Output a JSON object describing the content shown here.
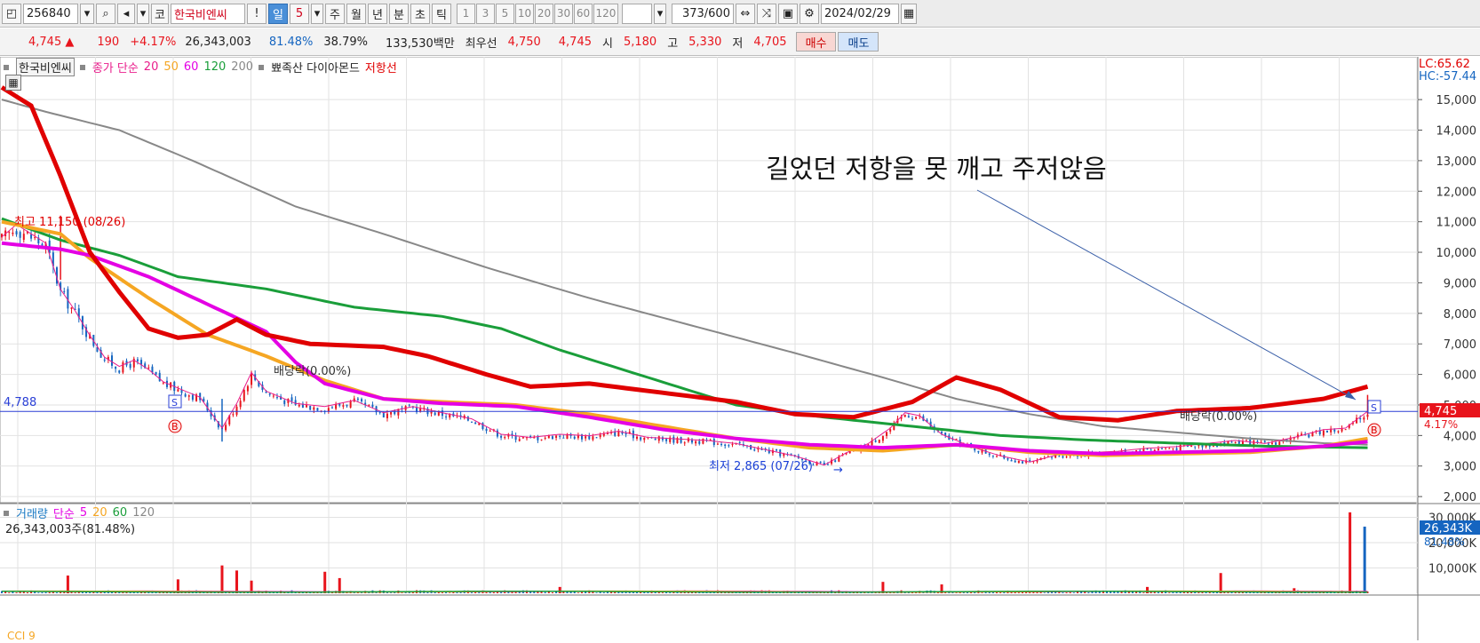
{
  "toolbar": {
    "code": "256840",
    "market": "코",
    "name": "한국비엔씨",
    "exclam": "!",
    "period_day": "일",
    "period_n": "5",
    "period_week": "주",
    "period_month": "월",
    "period_year": "년",
    "period_min": "분",
    "period_sec": "초",
    "period_tick": "틱",
    "intervals": [
      "1",
      "3",
      "5",
      "10",
      "20",
      "30",
      "60",
      "120"
    ],
    "count": "373",
    "count_max": "/600",
    "date": "2024/02/29"
  },
  "quote": {
    "price": "4,745",
    "change_arrow": "▲",
    "change": "190",
    "change_pct": "+4.17%",
    "volume": "26,343,003",
    "volume_ratio": "81.48%",
    "turnover": "38.79%",
    "amount": "133,530백만",
    "best_label": "최우선",
    "best_ask": "4,750",
    "best_bid": "4,745",
    "open_label": "시",
    "open": "5,180",
    "high_label": "고",
    "high": "5,330",
    "low_label": "저",
    "low": "4,705",
    "buy_label": "매수",
    "sell_label": "매도"
  },
  "legend": {
    "stock": "한국비엔씨",
    "ma_label": "종가 단순",
    "ma_periods": [
      "20",
      "50",
      "60",
      "120",
      "200"
    ],
    "ma_colors": [
      "#e91e8c",
      "#f5a623",
      "#e400e4",
      "#1a9e3a",
      "#888888"
    ],
    "extra1": "뾰족산 다이아몬드",
    "extra2": "저항선"
  },
  "vol_legend": {
    "label": "거래량",
    "ma_label": "단순",
    "periods": [
      "5",
      "20",
      "60",
      "120"
    ],
    "colors": [
      "#e400e4",
      "#f5a623",
      "#1a9e3a",
      "#888888"
    ],
    "value": "26,343,003주(81.48%)"
  },
  "right_info": {
    "lc": "LC:65.62",
    "hc": "HC:-57.44"
  },
  "annotations": {
    "max_label": "최고 11,150 (08/26)",
    "min_label": "최저 2,865 (07/26)",
    "dividend1": "배당락(0.00%)",
    "dividend2": "배당락(0.00%)",
    "hline_value": "4,788",
    "comment": "길었던 저항을 못 깨고 주저앉음",
    "sell_marker": "S",
    "buy_marker": "B",
    "price_tag": "4,745",
    "pct_tag": "4.17%",
    "vol_tag": "26,343K",
    "vol_pct_tag": "81.48%",
    "bottom_label": "CCI 9"
  },
  "colors": {
    "up": "#e8141c",
    "down": "#1565c0",
    "resistance": "#e00000",
    "hline": "#2a3fd6"
  },
  "chart_data": {
    "type": "candlestick",
    "y_ticks": [
      15000,
      14000,
      13000,
      12000,
      11000,
      10000,
      9000,
      8000,
      7000,
      6000,
      5000,
      4000,
      3000,
      2000
    ],
    "y_tick_labels": [
      "15,000",
      "14,000",
      "13,000",
      "12,000",
      "11,000",
      "10,000",
      "9,000",
      "8,000",
      "7,000",
      "6,000",
      "5,000",
      "4,000",
      "3,000",
      "2,000"
    ],
    "ylim": [
      1800,
      16400
    ],
    "n_bars": 373,
    "anchors_close": [
      [
        0,
        10400
      ],
      [
        10,
        10800
      ],
      [
        20,
        10500
      ],
      [
        30,
        10200
      ],
      [
        40,
        8700
      ],
      [
        50,
        8000
      ],
      [
        60,
        7200
      ],
      [
        70,
        6500
      ],
      [
        80,
        6200
      ],
      [
        90,
        6400
      ],
      [
        100,
        6100
      ],
      [
        110,
        5700
      ],
      [
        120,
        5500
      ],
      [
        135,
        5200
      ],
      [
        150,
        4200
      ],
      [
        160,
        5000
      ],
      [
        170,
        6000
      ],
      [
        180,
        5400
      ],
      [
        190,
        5200
      ],
      [
        200,
        5000
      ],
      [
        220,
        4900
      ],
      [
        240,
        5100
      ],
      [
        260,
        4700
      ],
      [
        280,
        4900
      ],
      [
        300,
        4700
      ],
      [
        320,
        4500
      ],
      [
        340,
        4000
      ],
      [
        360,
        3900
      ],
      [
        380,
        4000
      ],
      [
        400,
        3950
      ],
      [
        420,
        4100
      ],
      [
        440,
        3900
      ],
      [
        460,
        3850
      ],
      [
        480,
        3800
      ],
      [
        500,
        3700
      ],
      [
        520,
        3500
      ],
      [
        540,
        3300
      ],
      [
        560,
        3000
      ],
      [
        575,
        3400
      ],
      [
        590,
        3700
      ],
      [
        605,
        4200
      ],
      [
        615,
        4700
      ],
      [
        625,
        4600
      ],
      [
        640,
        4000
      ],
      [
        660,
        3600
      ],
      [
        680,
        3300
      ],
      [
        700,
        3100
      ],
      [
        720,
        3350
      ],
      [
        740,
        3400
      ],
      [
        760,
        3450
      ],
      [
        780,
        3550
      ],
      [
        800,
        3600
      ],
      [
        820,
        3700
      ],
      [
        840,
        3800
      ],
      [
        860,
        3700
      ],
      [
        880,
        3900
      ],
      [
        900,
        4150
      ],
      [
        915,
        4200
      ],
      [
        930,
        4745
      ]
    ],
    "ma_200": [
      [
        0,
        15000
      ],
      [
        30,
        14600
      ],
      [
        80,
        14000
      ],
      [
        130,
        13000
      ],
      [
        200,
        11500
      ],
      [
        260,
        10600
      ],
      [
        330,
        9500
      ],
      [
        400,
        8500
      ],
      [
        470,
        7600
      ],
      [
        540,
        6700
      ],
      [
        600,
        5900
      ],
      [
        650,
        5200
      ],
      [
        700,
        4700
      ],
      [
        750,
        4300
      ],
      [
        800,
        4100
      ],
      [
        850,
        3900
      ],
      [
        900,
        3750
      ],
      [
        930,
        3700
      ]
    ],
    "ma_60": [
      [
        0,
        10300
      ],
      [
        20,
        10200
      ],
      [
        40,
        10100
      ],
      [
        60,
        9900
      ],
      [
        100,
        9200
      ],
      [
        140,
        8300
      ],
      [
        180,
        7400
      ],
      [
        200,
        6400
      ],
      [
        220,
        5700
      ],
      [
        260,
        5200
      ],
      [
        300,
        5050
      ],
      [
        350,
        4950
      ],
      [
        400,
        4600
      ],
      [
        450,
        4200
      ],
      [
        500,
        3900
      ],
      [
        550,
        3700
      ],
      [
        600,
        3600
      ],
      [
        650,
        3700
      ],
      [
        700,
        3500
      ],
      [
        750,
        3400
      ],
      [
        800,
        3450
      ],
      [
        850,
        3500
      ],
      [
        900,
        3650
      ],
      [
        930,
        3800
      ]
    ],
    "ma_50": [
      [
        0,
        11000
      ],
      [
        20,
        10800
      ],
      [
        40,
        10600
      ],
      [
        60,
        9800
      ],
      [
        100,
        8500
      ],
      [
        140,
        7300
      ],
      [
        180,
        6600
      ],
      [
        220,
        5800
      ],
      [
        260,
        5200
      ],
      [
        300,
        5100
      ],
      [
        350,
        5000
      ],
      [
        400,
        4700
      ],
      [
        450,
        4300
      ],
      [
        500,
        3900
      ],
      [
        550,
        3600
      ],
      [
        600,
        3500
      ],
      [
        650,
        3700
      ],
      [
        700,
        3450
      ],
      [
        750,
        3350
      ],
      [
        800,
        3400
      ],
      [
        850,
        3450
      ],
      [
        900,
        3650
      ],
      [
        930,
        3900
      ]
    ],
    "ma_120": [
      [
        0,
        11100
      ],
      [
        40,
        10400
      ],
      [
        80,
        9900
      ],
      [
        120,
        9200
      ],
      [
        180,
        8800
      ],
      [
        240,
        8200
      ],
      [
        300,
        7900
      ],
      [
        340,
        7500
      ],
      [
        380,
        6800
      ],
      [
        420,
        6200
      ],
      [
        460,
        5600
      ],
      [
        500,
        5000
      ],
      [
        560,
        4600
      ],
      [
        620,
        4300
      ],
      [
        680,
        4000
      ],
      [
        740,
        3850
      ],
      [
        800,
        3750
      ],
      [
        860,
        3650
      ],
      [
        930,
        3600
      ]
    ],
    "resistance": [
      [
        0,
        15400
      ],
      [
        20,
        14800
      ],
      [
        40,
        12500
      ],
      [
        60,
        10000
      ],
      [
        80,
        8700
      ],
      [
        100,
        7500
      ],
      [
        120,
        7200
      ],
      [
        140,
        7300
      ],
      [
        160,
        7800
      ],
      [
        180,
        7300
      ],
      [
        210,
        7000
      ],
      [
        260,
        6900
      ],
      [
        290,
        6600
      ],
      [
        330,
        6000
      ],
      [
        360,
        5600
      ],
      [
        400,
        5700
      ],
      [
        450,
        5400
      ],
      [
        500,
        5100
      ],
      [
        540,
        4700
      ],
      [
        580,
        4600
      ],
      [
        620,
        5100
      ],
      [
        650,
        5900
      ],
      [
        680,
        5500
      ],
      [
        720,
        4600
      ],
      [
        760,
        4500
      ],
      [
        800,
        4800
      ],
      [
        850,
        4900
      ],
      [
        900,
        5200
      ],
      [
        930,
        5600
      ]
    ]
  },
  "volume_data": {
    "y_ticks": [
      30000,
      20000,
      10000
    ],
    "y_tick_labels": [
      "30,000K",
      "20,000K",
      "10,000K"
    ],
    "ylim": [
      0,
      33000
    ],
    "spikes": [
      [
        45,
        7000
      ],
      [
        120,
        5500
      ],
      [
        150,
        11000
      ],
      [
        160,
        9000
      ],
      [
        170,
        5000
      ],
      [
        220,
        8500
      ],
      [
        230,
        6000
      ],
      [
        380,
        2500
      ],
      [
        600,
        4500
      ],
      [
        640,
        3500
      ],
      [
        780,
        2500
      ],
      [
        830,
        8000
      ],
      [
        880,
        2000
      ],
      [
        918,
        32000
      ],
      [
        928,
        26343
      ]
    ],
    "baseline": 600
  }
}
